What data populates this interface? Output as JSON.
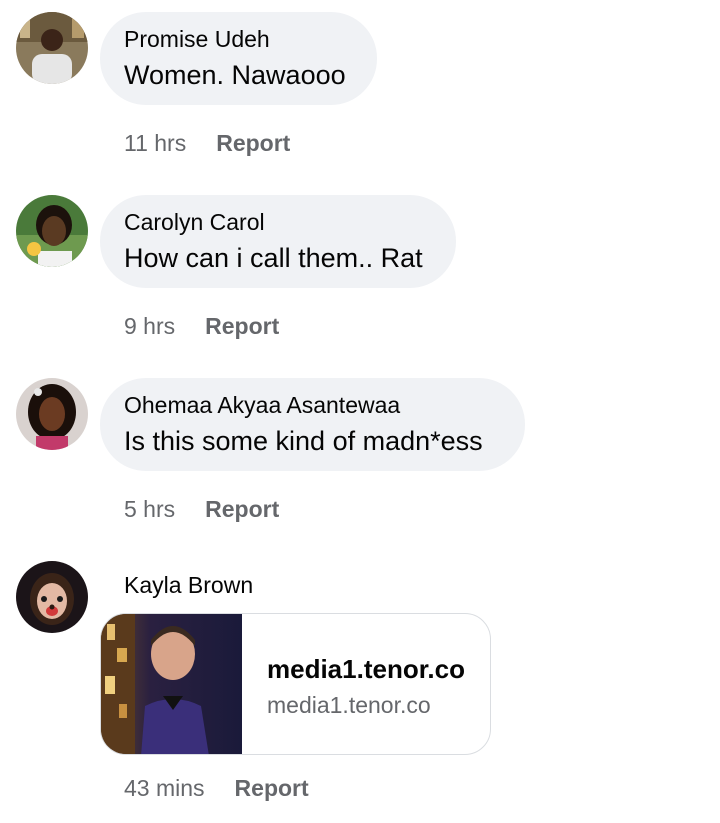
{
  "comments": [
    {
      "author": "Promise Udeh",
      "text": "Women. Nawaooo",
      "time": "11 hrs",
      "report_label": "Report"
    },
    {
      "author": "Carolyn Carol",
      "text": "How can i call them.. Rat",
      "time": "9 hrs",
      "report_label": "Report"
    },
    {
      "author": "Ohemaa Akyaa Asantewaa",
      "text": "Is this some kind of madn*ess",
      "time": "5 hrs",
      "report_label": "Report"
    },
    {
      "author": "Kayla Brown",
      "link_title": "media1.tenor.co",
      "link_domain": "media1.tenor.co",
      "time": "43 mins",
      "report_label": "Report"
    }
  ],
  "colors": {
    "bubble_bg": "#f0f2f5",
    "secondary_text": "#65676b",
    "primary_text": "#050505"
  }
}
